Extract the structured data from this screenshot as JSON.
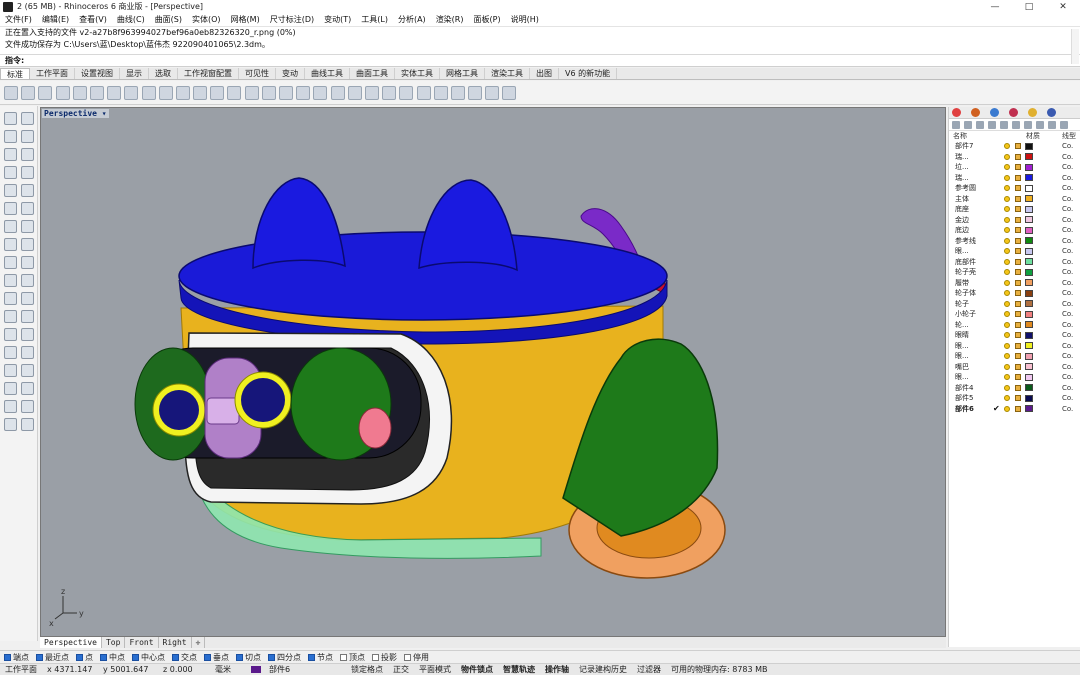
{
  "window": {
    "title": "2 (65 MB) - Rhinoceros 6 商业版 - [Perspective]",
    "min": "—",
    "max": "□",
    "close": "✕"
  },
  "menu": [
    "文件(F)",
    "编辑(E)",
    "查看(V)",
    "曲线(C)",
    "曲面(S)",
    "实体(O)",
    "网格(M)",
    "尺寸标注(D)",
    "变动(T)",
    "工具(L)",
    "分析(A)",
    "渲染(R)",
    "面板(P)",
    "说明(H)"
  ],
  "command": {
    "line1": "正在置入支持的文件 v2-a27b8f963994027bef96a0eb82326320_r.png (0%)",
    "line2": "文件成功保存为 C:\\Users\\蓝\\Desktop\\蓝伟杰 922090401065\\2.3dm。",
    "prompt": "指令:"
  },
  "tabs": [
    "标准",
    "工作平面",
    "设置视图",
    "显示",
    "选取",
    "工作视窗配置",
    "可见性",
    "变动",
    "曲线工具",
    "曲面工具",
    "实体工具",
    "网格工具",
    "渲染工具",
    "出图",
    "V6 的新功能"
  ],
  "viewport": {
    "label": "Perspective ▾",
    "axis_z": "z",
    "axis_y": "y",
    "axis_x": "x"
  },
  "viewtabs": [
    "Perspective",
    "Top",
    "Front",
    "Right",
    "✛"
  ],
  "layers": {
    "header_name": "名称",
    "header_material": "材质",
    "header_linetype": "线型",
    "rows": [
      {
        "name": "部件7",
        "color": "#111111",
        "lt": "Co."
      },
      {
        "name": "瑞...",
        "color": "#cc1111",
        "lt": "Co."
      },
      {
        "name": "垃...",
        "color": "#a020d0",
        "lt": "Co."
      },
      {
        "name": "瑞...",
        "color": "#1a1ae0",
        "lt": "Co."
      },
      {
        "name": "参考圆",
        "color": "#ffffff",
        "lt": "Co."
      },
      {
        "name": "主体",
        "color": "#f0b020",
        "lt": "Co."
      },
      {
        "name": "底座",
        "color": "#c9c9f0",
        "lt": "Co."
      },
      {
        "name": "金边",
        "color": "#f0c8e0",
        "lt": "Co."
      },
      {
        "name": "底边",
        "color": "#e060c0",
        "lt": "Co."
      },
      {
        "name": "参考线",
        "color": "#108a10",
        "lt": "Co."
      },
      {
        "name": "眼...",
        "color": "#c8c8f0",
        "lt": "Co."
      },
      {
        "name": "底部件",
        "color": "#70e0a0",
        "lt": "Co."
      },
      {
        "name": "轮子壳",
        "color": "#10a040",
        "lt": "Co."
      },
      {
        "name": "履带",
        "color": "#f0a060",
        "lt": "Co."
      },
      {
        "name": "轮子体",
        "color": "#8a4010",
        "lt": "Co."
      },
      {
        "name": "轮子",
        "color": "#b07040",
        "lt": "Co."
      },
      {
        "name": "小轮子",
        "color": "#f08080",
        "lt": "Co."
      },
      {
        "name": "轮...",
        "color": "#e08a20",
        "lt": "Co."
      },
      {
        "name": "眼睛",
        "color": "#10106a",
        "lt": "Co."
      },
      {
        "name": "眼...",
        "color": "#f0f020",
        "lt": "Co."
      },
      {
        "name": "眼...",
        "color": "#f0a0b0",
        "lt": "Co."
      },
      {
        "name": "嘴巴",
        "color": "#f8c0d0",
        "lt": "Co."
      },
      {
        "name": "眼...",
        "color": "#f0c8f0",
        "lt": "Co."
      },
      {
        "name": "部件4",
        "color": "#0a5a1a",
        "lt": "Co."
      },
      {
        "name": "部件5",
        "color": "#0a0a50",
        "lt": "Co."
      },
      {
        "name": "部件6",
        "color": "#5b1a8c",
        "lt": "Co.",
        "current": true
      }
    ]
  },
  "snaps": [
    {
      "label": "端点",
      "on": true
    },
    {
      "label": "最近点",
      "on": true
    },
    {
      "label": "点",
      "on": true
    },
    {
      "label": "中点",
      "on": true
    },
    {
      "label": "中心点",
      "on": true
    },
    {
      "label": "交点",
      "on": true
    },
    {
      "label": "垂点",
      "on": true
    },
    {
      "label": "切点",
      "on": true
    },
    {
      "label": "四分点",
      "on": true
    },
    {
      "label": "节点",
      "on": true
    },
    {
      "label": "顶点",
      "on": false
    },
    {
      "label": "投影",
      "on": false
    },
    {
      "label": "停用",
      "on": false
    }
  ],
  "status": {
    "cplane": "工作平面",
    "x": "x 4371.147",
    "y": "y 5001.647",
    "z": "z 0.000",
    "units": "毫米",
    "layer": "部件6",
    "grid_snap": "锁定格点",
    "ortho": "正交",
    "planar": "平面模式",
    "osnap": "物件锁点",
    "smarttrack": "智慧轨迹",
    "gumball": "操作轴",
    "history": "记录建构历史",
    "filter": "过滤器",
    "memory": "可用的物理内存: 8783 MB"
  },
  "colors": {
    "viewport_bg": "#9a9fa6",
    "body_yellow": "#e8b21e",
    "top_blue": "#1a1ad8",
    "track_green": "#1e7a1a"
  }
}
